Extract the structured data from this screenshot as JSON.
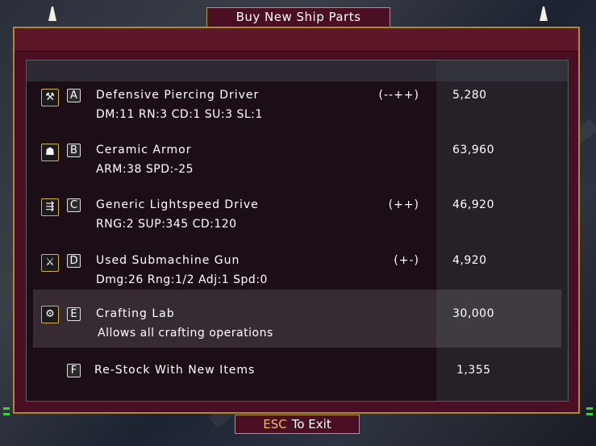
{
  "title": "Buy New Ship Parts",
  "items": [
    {
      "key": "A",
      "icon": "piercing-driver-icon",
      "glyph": "⚒",
      "name": "Defensive Piercing Driver",
      "stats": "DM:11  RN:3  CD:1  SU:3  SL:1",
      "mod": "(--++)",
      "price": "5,280"
    },
    {
      "key": "B",
      "icon": "armor-icon",
      "glyph": "☗",
      "name": "Ceramic Armor",
      "stats": "ARM:38  SPD:-25",
      "mod": "",
      "price": "63,960"
    },
    {
      "key": "C",
      "icon": "drive-icon",
      "glyph": "⇶",
      "name": "Generic Lightspeed Drive",
      "stats": "RNG:2  SUP:345  CD:120",
      "mod": "(++)",
      "price": "46,920"
    },
    {
      "key": "D",
      "icon": "gun-icon",
      "glyph": "⚔",
      "name": "Used Submachine Gun",
      "stats": "Dmg:26  Rng:1/2  Adj:1  Spd:0",
      "mod": "(+-)",
      "price": "4,920"
    },
    {
      "key": "E",
      "icon": "crafting-gear-icon",
      "glyph": "⚙",
      "name": "Crafting Lab",
      "stats": "Allows all crafting operations",
      "mod": "",
      "price": "30,000"
    },
    {
      "key": "F",
      "icon": "",
      "glyph": "",
      "name": "Re-Stock With New Items",
      "stats": "",
      "mod": "",
      "price": "1,355"
    }
  ],
  "exit": {
    "key": "ESC",
    "label": "To Exit"
  }
}
